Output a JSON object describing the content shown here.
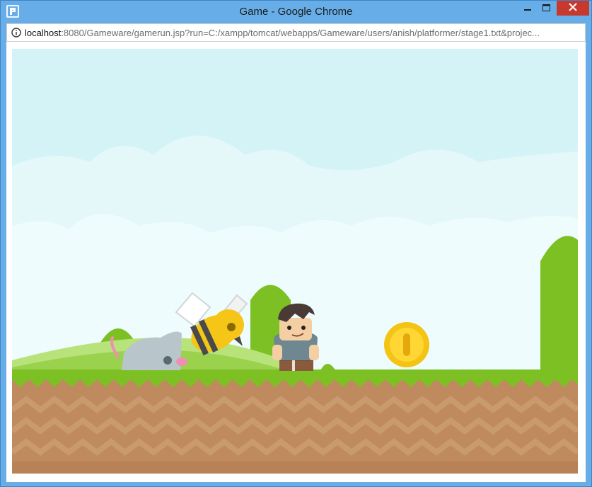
{
  "window": {
    "title": "Game - Google Chrome",
    "accent": "#67aee8",
    "close_color": "#c7382f"
  },
  "address": {
    "host": "localhost",
    "rest": ":8080/Gameware/gamerun.jsp?run=C:/xampp/tomcat/webapps/Gameware/users/anish/platformer/stage1.txt&projec..."
  },
  "game": {
    "sky_color": "#d3f3f7",
    "ground_color": "#be8a5e",
    "grass_color": "#7cc024",
    "sprites": [
      "mouse-enemy",
      "bee-enemy",
      "player-character",
      "gold-coin"
    ]
  }
}
